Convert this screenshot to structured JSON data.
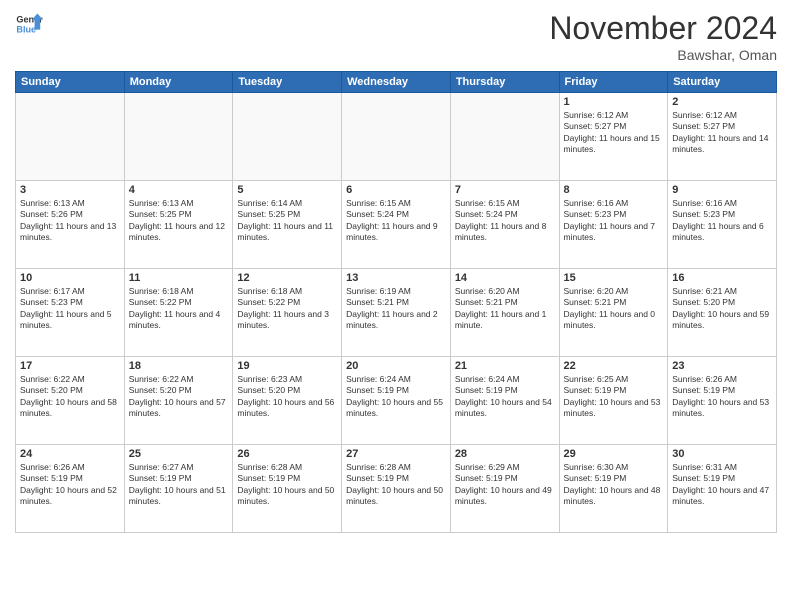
{
  "header": {
    "logo_general": "General",
    "logo_blue": "Blue",
    "month_title": "November 2024",
    "location": "Bawshar, Oman"
  },
  "weekdays": [
    "Sunday",
    "Monday",
    "Tuesday",
    "Wednesday",
    "Thursday",
    "Friday",
    "Saturday"
  ],
  "weeks": [
    [
      {
        "day": "",
        "info": ""
      },
      {
        "day": "",
        "info": ""
      },
      {
        "day": "",
        "info": ""
      },
      {
        "day": "",
        "info": ""
      },
      {
        "day": "",
        "info": ""
      },
      {
        "day": "1",
        "info": "Sunrise: 6:12 AM\nSunset: 5:27 PM\nDaylight: 11 hours and 15 minutes."
      },
      {
        "day": "2",
        "info": "Sunrise: 6:12 AM\nSunset: 5:27 PM\nDaylight: 11 hours and 14 minutes."
      }
    ],
    [
      {
        "day": "3",
        "info": "Sunrise: 6:13 AM\nSunset: 5:26 PM\nDaylight: 11 hours and 13 minutes."
      },
      {
        "day": "4",
        "info": "Sunrise: 6:13 AM\nSunset: 5:25 PM\nDaylight: 11 hours and 12 minutes."
      },
      {
        "day": "5",
        "info": "Sunrise: 6:14 AM\nSunset: 5:25 PM\nDaylight: 11 hours and 11 minutes."
      },
      {
        "day": "6",
        "info": "Sunrise: 6:15 AM\nSunset: 5:24 PM\nDaylight: 11 hours and 9 minutes."
      },
      {
        "day": "7",
        "info": "Sunrise: 6:15 AM\nSunset: 5:24 PM\nDaylight: 11 hours and 8 minutes."
      },
      {
        "day": "8",
        "info": "Sunrise: 6:16 AM\nSunset: 5:23 PM\nDaylight: 11 hours and 7 minutes."
      },
      {
        "day": "9",
        "info": "Sunrise: 6:16 AM\nSunset: 5:23 PM\nDaylight: 11 hours and 6 minutes."
      }
    ],
    [
      {
        "day": "10",
        "info": "Sunrise: 6:17 AM\nSunset: 5:23 PM\nDaylight: 11 hours and 5 minutes."
      },
      {
        "day": "11",
        "info": "Sunrise: 6:18 AM\nSunset: 5:22 PM\nDaylight: 11 hours and 4 minutes."
      },
      {
        "day": "12",
        "info": "Sunrise: 6:18 AM\nSunset: 5:22 PM\nDaylight: 11 hours and 3 minutes."
      },
      {
        "day": "13",
        "info": "Sunrise: 6:19 AM\nSunset: 5:21 PM\nDaylight: 11 hours and 2 minutes."
      },
      {
        "day": "14",
        "info": "Sunrise: 6:20 AM\nSunset: 5:21 PM\nDaylight: 11 hours and 1 minute."
      },
      {
        "day": "15",
        "info": "Sunrise: 6:20 AM\nSunset: 5:21 PM\nDaylight: 11 hours and 0 minutes."
      },
      {
        "day": "16",
        "info": "Sunrise: 6:21 AM\nSunset: 5:20 PM\nDaylight: 10 hours and 59 minutes."
      }
    ],
    [
      {
        "day": "17",
        "info": "Sunrise: 6:22 AM\nSunset: 5:20 PM\nDaylight: 10 hours and 58 minutes."
      },
      {
        "day": "18",
        "info": "Sunrise: 6:22 AM\nSunset: 5:20 PM\nDaylight: 10 hours and 57 minutes."
      },
      {
        "day": "19",
        "info": "Sunrise: 6:23 AM\nSunset: 5:20 PM\nDaylight: 10 hours and 56 minutes."
      },
      {
        "day": "20",
        "info": "Sunrise: 6:24 AM\nSunset: 5:19 PM\nDaylight: 10 hours and 55 minutes."
      },
      {
        "day": "21",
        "info": "Sunrise: 6:24 AM\nSunset: 5:19 PM\nDaylight: 10 hours and 54 minutes."
      },
      {
        "day": "22",
        "info": "Sunrise: 6:25 AM\nSunset: 5:19 PM\nDaylight: 10 hours and 53 minutes."
      },
      {
        "day": "23",
        "info": "Sunrise: 6:26 AM\nSunset: 5:19 PM\nDaylight: 10 hours and 53 minutes."
      }
    ],
    [
      {
        "day": "24",
        "info": "Sunrise: 6:26 AM\nSunset: 5:19 PM\nDaylight: 10 hours and 52 minutes."
      },
      {
        "day": "25",
        "info": "Sunrise: 6:27 AM\nSunset: 5:19 PM\nDaylight: 10 hours and 51 minutes."
      },
      {
        "day": "26",
        "info": "Sunrise: 6:28 AM\nSunset: 5:19 PM\nDaylight: 10 hours and 50 minutes."
      },
      {
        "day": "27",
        "info": "Sunrise: 6:28 AM\nSunset: 5:19 PM\nDaylight: 10 hours and 50 minutes."
      },
      {
        "day": "28",
        "info": "Sunrise: 6:29 AM\nSunset: 5:19 PM\nDaylight: 10 hours and 49 minutes."
      },
      {
        "day": "29",
        "info": "Sunrise: 6:30 AM\nSunset: 5:19 PM\nDaylight: 10 hours and 48 minutes."
      },
      {
        "day": "30",
        "info": "Sunrise: 6:31 AM\nSunset: 5:19 PM\nDaylight: 10 hours and 47 minutes."
      }
    ]
  ]
}
